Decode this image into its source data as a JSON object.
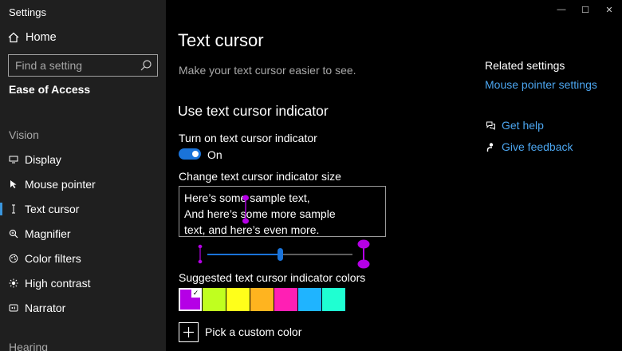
{
  "window": {
    "title": "Settings",
    "controls": {
      "minimize": "—",
      "maximize": "☐",
      "close": "✕"
    }
  },
  "sidebar": {
    "home_label": "Home",
    "search_placeholder": "Find a setting",
    "section": "Ease of Access",
    "groups": [
      {
        "label": "Vision"
      },
      {
        "label": "Hearing"
      }
    ],
    "items": [
      {
        "label": "Display",
        "icon": "display-icon",
        "active": false
      },
      {
        "label": "Mouse pointer",
        "icon": "mouse-pointer-icon",
        "active": false
      },
      {
        "label": "Text cursor",
        "icon": "text-cursor-icon",
        "active": true
      },
      {
        "label": "Magnifier",
        "icon": "magnifier-icon",
        "active": false
      },
      {
        "label": "Color filters",
        "icon": "color-filters-icon",
        "active": false
      },
      {
        "label": "High contrast",
        "icon": "high-contrast-icon",
        "active": false
      },
      {
        "label": "Narrator",
        "icon": "narrator-icon",
        "active": false
      }
    ]
  },
  "main": {
    "title": "Text cursor",
    "description": "Make your text cursor easier to see.",
    "indicator": {
      "heading": "Use text cursor indicator",
      "toggle_label": "Turn on text cursor indicator",
      "toggle_state": "On",
      "toggle_on": true,
      "size_label": "Change text cursor indicator size",
      "sample_lines": [
        "Here’s some sample text,",
        "And here’s some more sample",
        "text, and here’s even more."
      ],
      "size_value_fraction": 0.5,
      "colors_label": "Suggested text cursor indicator colors",
      "colors": [
        "#b500e6",
        "#c0ff1f",
        "#ffff1a",
        "#ffb41f",
        "#ff1fb4",
        "#1fb4ff",
        "#1fffd2"
      ],
      "selected_color_index": 0,
      "custom_color_label": "Pick a custom color"
    }
  },
  "related": {
    "heading": "Related settings",
    "link": "Mouse pointer settings",
    "help": [
      {
        "label": "Get help",
        "icon": "help-chat-icon"
      },
      {
        "label": "Give feedback",
        "icon": "feedback-icon"
      }
    ]
  },
  "accent_color": "#1a73d9",
  "link_color": "#4ca6f0"
}
